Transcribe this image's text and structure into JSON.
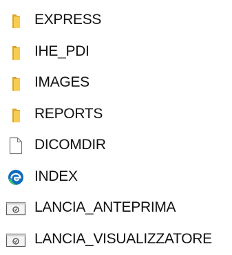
{
  "colors": {
    "text": "#111111",
    "folder_front": "#f7cc53",
    "folder_back": "#dca52d",
    "file_outline": "#7a7a7a",
    "edge_blue": "#0f6cbd",
    "edge_green": "#3cc16c"
  },
  "files": [
    {
      "name": "EXPRESS",
      "icon": "folder-icon"
    },
    {
      "name": "IHE_PDI",
      "icon": "folder-icon"
    },
    {
      "name": "IMAGES",
      "icon": "folder-icon"
    },
    {
      "name": "REPORTS",
      "icon": "folder-icon"
    },
    {
      "name": "DICOMDIR",
      "icon": "blank-file-icon"
    },
    {
      "name": "INDEX",
      "icon": "edge-browser-icon"
    },
    {
      "name": "LANCIA_ANTEPRIMA",
      "icon": "application-icon"
    },
    {
      "name": "LANCIA_VISUALIZZATORE",
      "icon": "application-icon"
    }
  ]
}
